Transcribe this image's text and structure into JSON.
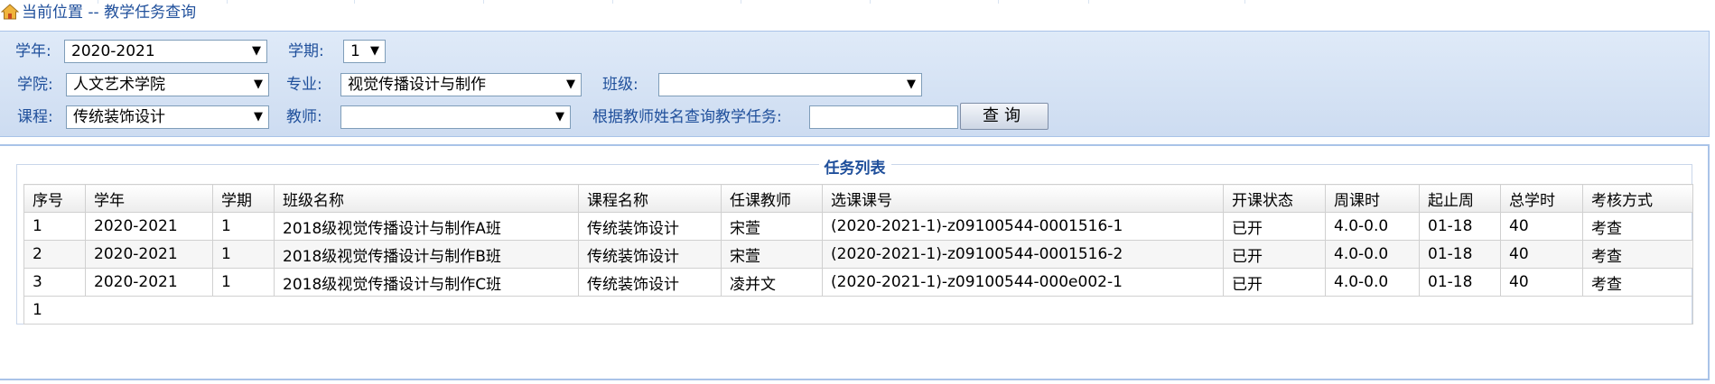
{
  "breadcrumb": {
    "label": "当前位置",
    "separator": "--",
    "page": "教学任务查询"
  },
  "filters": {
    "year_label": "学年:",
    "year_value": "2020-2021",
    "term_label": "学期:",
    "term_value": "1",
    "college_label": "学院:",
    "college_value": "人文艺术学院",
    "major_label": "专业:",
    "major_value": "视觉传播设计与制作",
    "class_label": "班级:",
    "class_value": "",
    "course_label": "课程:",
    "course_value": "传统装饰设计",
    "teacher_label": "教师:",
    "teacher_value": "",
    "name_query_label": "根据教师姓名查询教学任务:",
    "name_query_value": "",
    "query_button": "查询"
  },
  "task_list": {
    "title": "任务列表",
    "columns": [
      "序号",
      "学年",
      "学期",
      "班级名称",
      "课程名称",
      "任课教师",
      "选课课号",
      "开课状态",
      "周课时",
      "起止周",
      "总学时",
      "考核方式"
    ],
    "rows": [
      [
        "1",
        "2020-2021",
        "1",
        "2018级视觉传播设计与制作A班",
        "传统装饰设计",
        "宋萱",
        "(2020-2021-1)-z09100544-0001516-1",
        "已开",
        "4.0-0.0",
        "01-18",
        "40",
        "考查"
      ],
      [
        "2",
        "2020-2021",
        "1",
        "2018级视觉传播设计与制作B班",
        "传统装饰设计",
        "宋萱",
        "(2020-2021-1)-z09100544-0001516-2",
        "已开",
        "4.0-0.0",
        "01-18",
        "40",
        "考查"
      ],
      [
        "3",
        "2020-2021",
        "1",
        "2018级视觉传播设计与制作C班",
        "传统装饰设计",
        "凌并文",
        "(2020-2021-1)-z09100544-000e002-1",
        "已开",
        "4.0-0.0",
        "01-18",
        "40",
        "考查"
      ]
    ],
    "pager": "1"
  },
  "colors": {
    "accent_text": "#1f4f9b",
    "panel_bg": "#dfeaf8",
    "panel_border": "#a9c3e8"
  },
  "icons": {
    "home": "home-icon",
    "dropdown": "chevron-down-icon"
  }
}
